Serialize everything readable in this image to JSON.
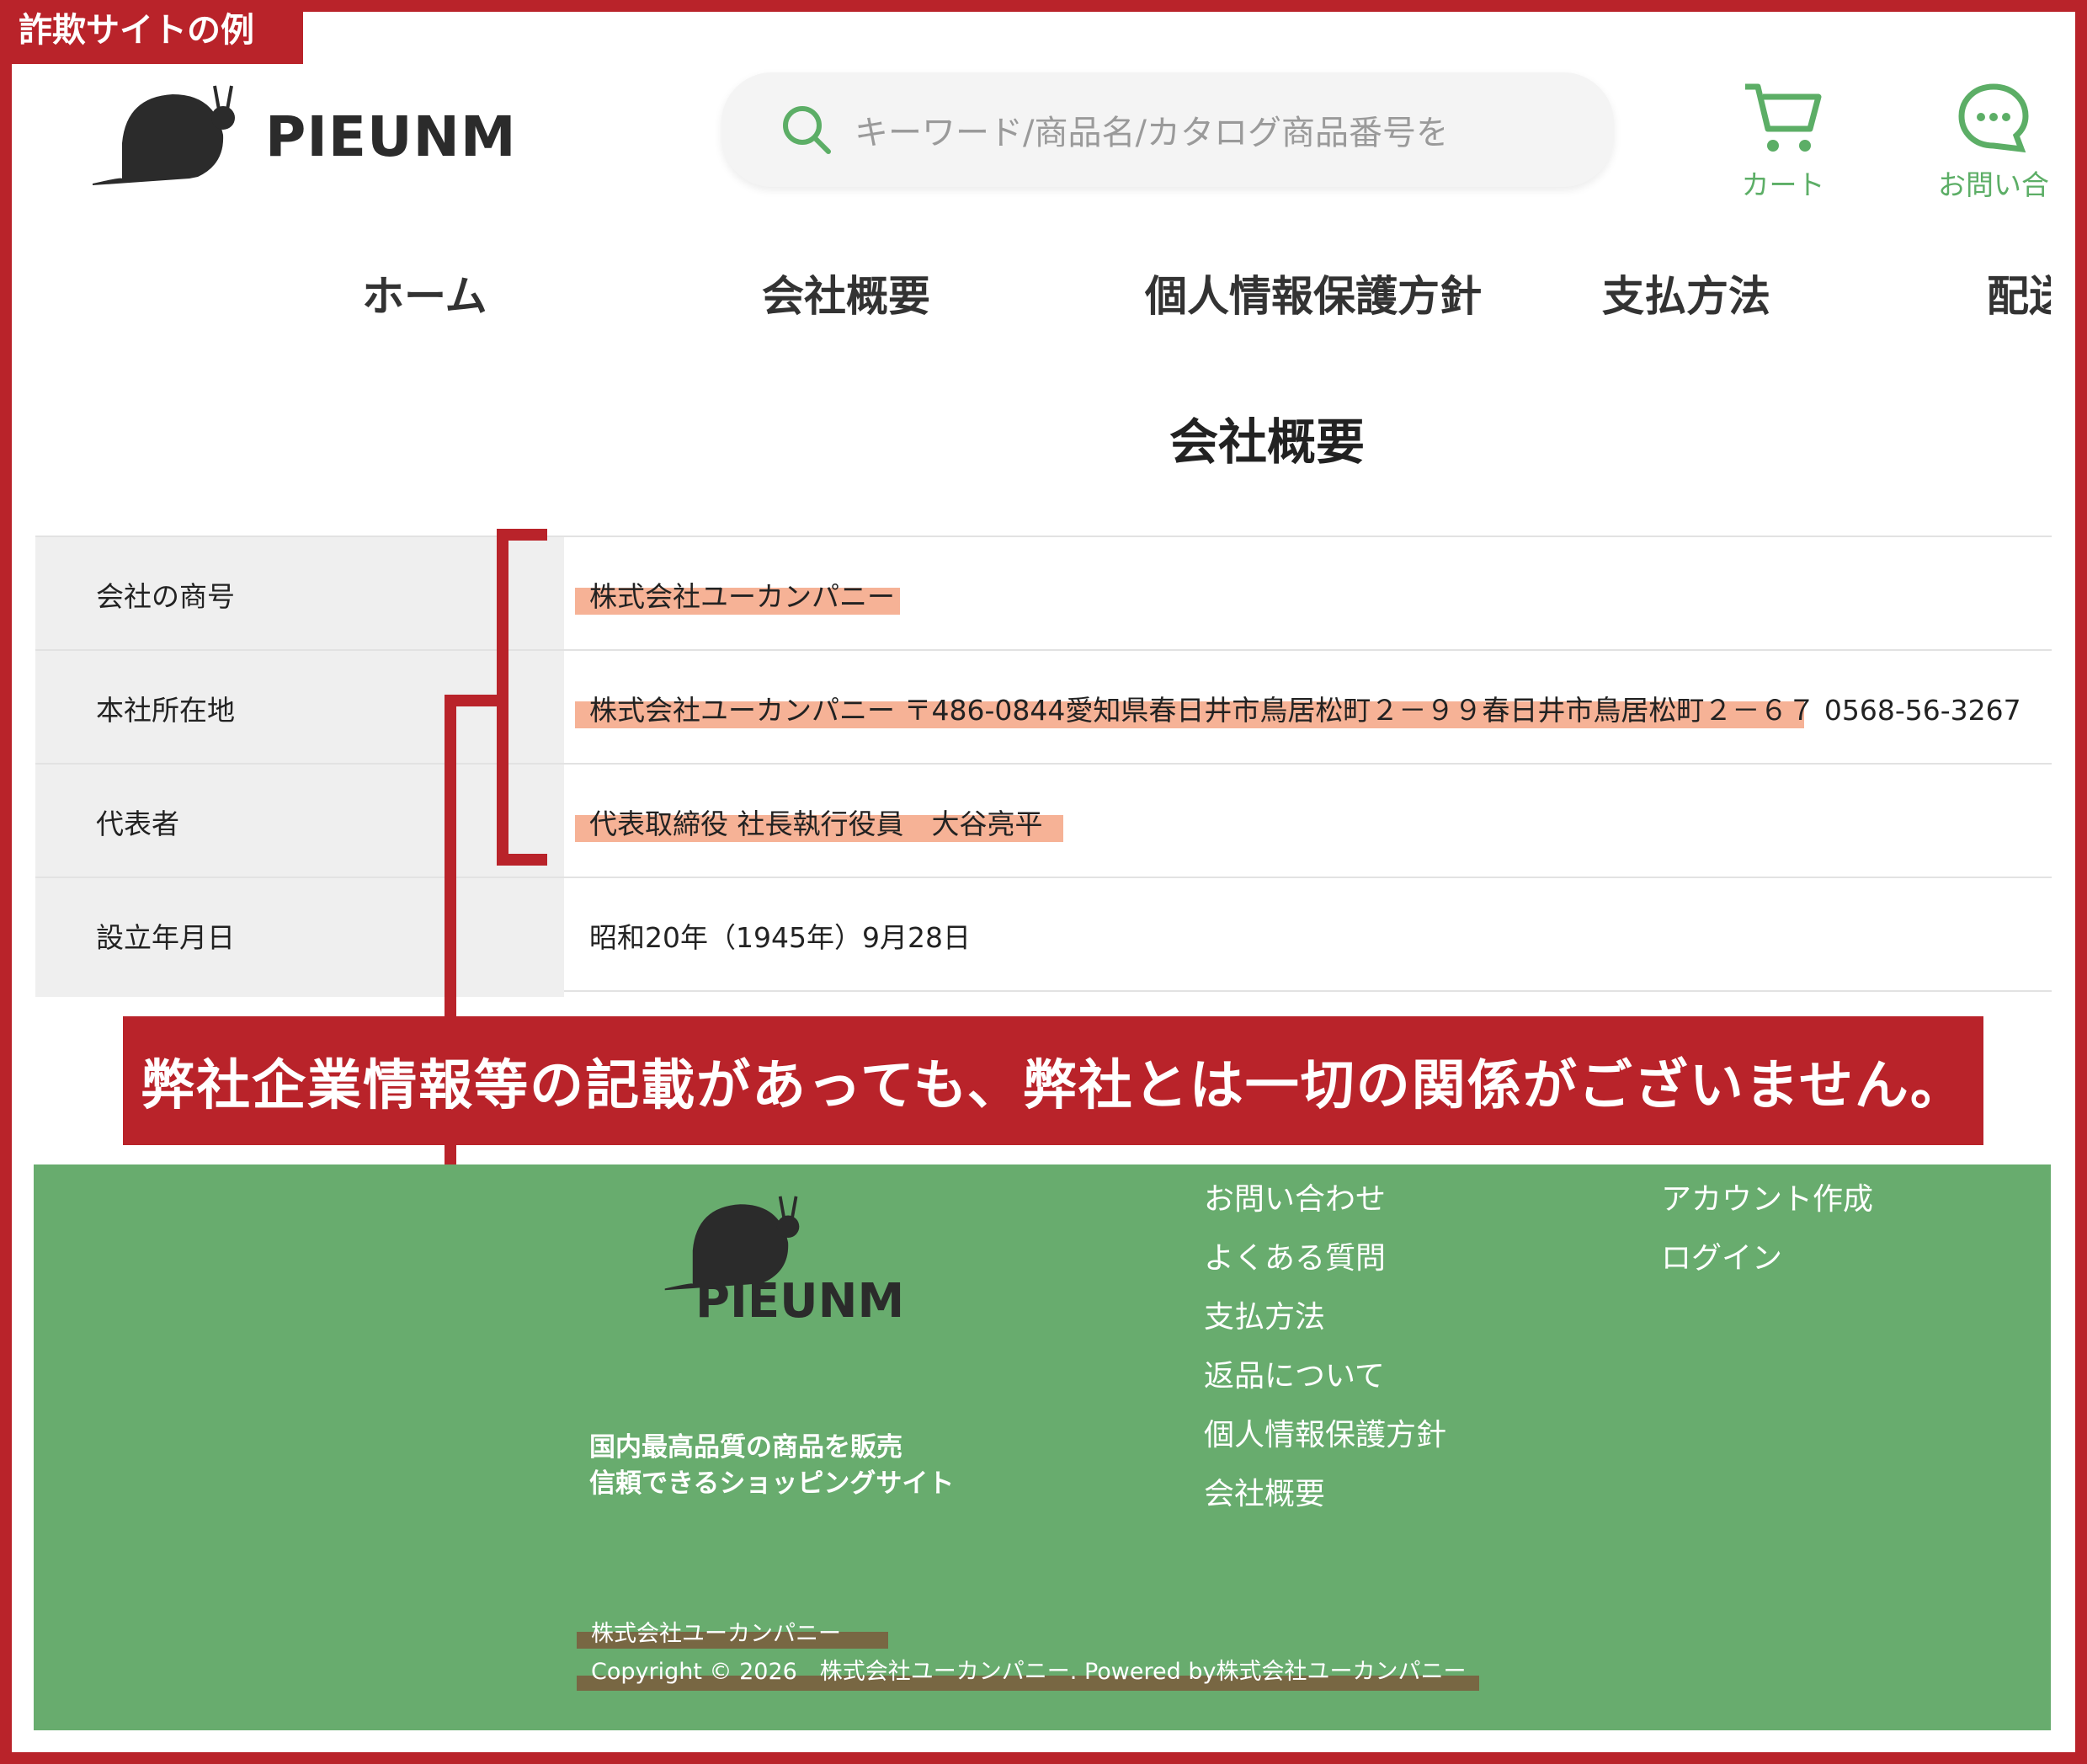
{
  "corner_label": "詐欺サイトの例",
  "header": {
    "brand": "PIEUNM",
    "search_placeholder": "キーワード/商品名/カタログ商品番号を",
    "cart_label": "カート",
    "contact_label": "お問い合"
  },
  "nav": [
    "ホーム",
    "会社概要",
    "個人情報保護方針",
    "支払方法",
    "配送"
  ],
  "page_title": "会社概要",
  "company_table": [
    {
      "label": "会社の商号",
      "value": "株式会社ユーカンパニー"
    },
    {
      "label": "本社所在地",
      "value": "株式会社ユーカンパニー 〒486-0844愛知県春日井市鳥居松町２－９９春日井市鳥居松町２－６７ 0568-56-3267"
    },
    {
      "label": "代表者",
      "value": "代表取締役 社長執行役員　大谷亮平"
    },
    {
      "label": "設立年月日",
      "value": "昭和20年（1945年）9月28日"
    }
  ],
  "banner": "弊社企業情報等の記載があっても、弊社とは一切の関係がございません。",
  "footer": {
    "brand": "PIEUNM",
    "tagline_1": "国内最高品質の商品を販売",
    "tagline_2": "信頼できるショッピングサイト",
    "links_col1": [
      "お問い合わせ",
      "よくある質問",
      "支払方法",
      "返品について",
      "個人情報保護方針",
      "会社概要"
    ],
    "links_col2": [
      "アカウント作成",
      "ログイン"
    ],
    "company": "株式会社ユーカンパニー",
    "copyright": "Copyright © 2026　株式会社ユーカンパニー. Powered by株式会社ユーカンパニー"
  },
  "colors": {
    "frame": "#b9232a",
    "accent_green": "#5cae66",
    "footer_bg": "#68ac6e",
    "highlight": "#f4a584"
  }
}
